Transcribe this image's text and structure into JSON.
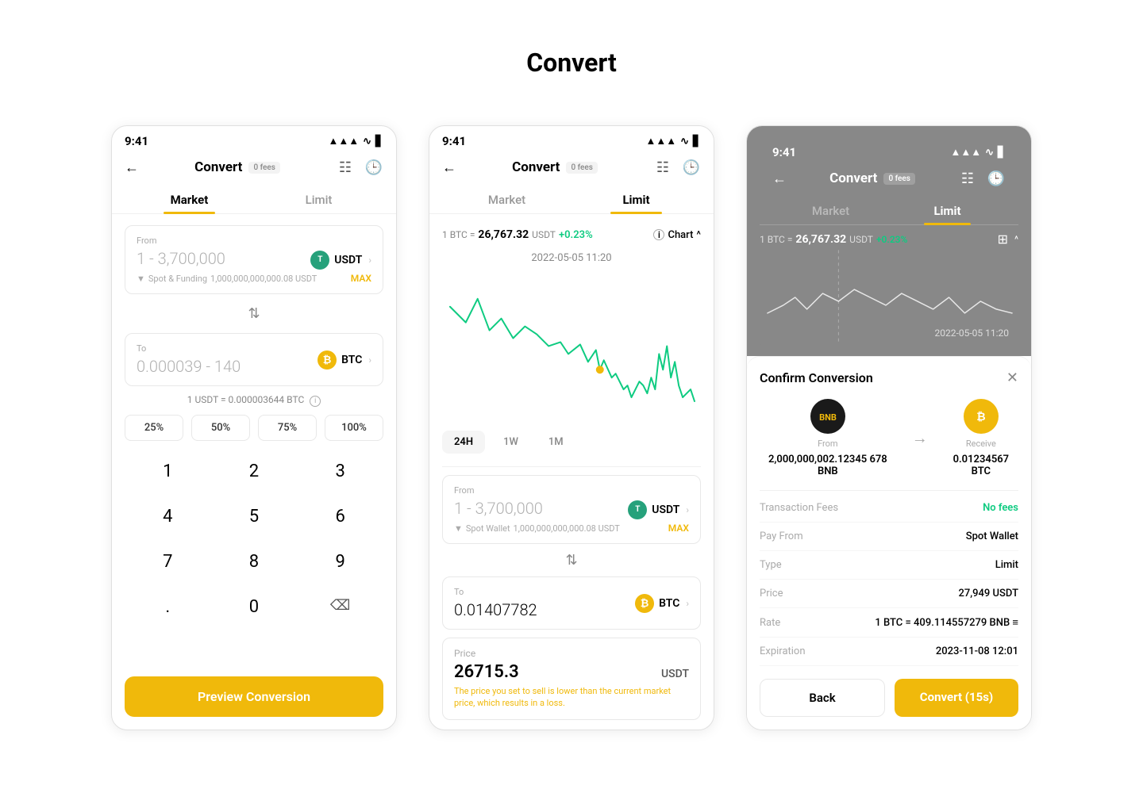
{
  "page": {
    "title": "Convert"
  },
  "screen1": {
    "status": {
      "time": "9:41",
      "signal": "▲▲▲",
      "wifi": "◀",
      "battery": "▋"
    },
    "header": {
      "title": "Convert",
      "badge": "0 fees"
    },
    "tabs": [
      {
        "label": "Market",
        "active": true
      },
      {
        "label": "Limit",
        "active": false
      }
    ],
    "from": {
      "label": "From",
      "value": "1 - 3,700,000",
      "currency": "USDT",
      "spot": "Spot & Funding",
      "balance": "1,000,000,000,000.08 USDT",
      "max": "MAX"
    },
    "to": {
      "label": "To",
      "value": "0.000039 - 140",
      "currency": "BTC"
    },
    "rate": "1 USDT = 0.000003644 BTC",
    "percentages": [
      "25%",
      "50%",
      "75%",
      "100%"
    ],
    "numpad": [
      "1",
      "2",
      "3",
      "4",
      "5",
      "6",
      "7",
      "8",
      "9",
      ".",
      "0",
      "⌫"
    ],
    "preview_btn": "Preview Conversion"
  },
  "screen2": {
    "status": {
      "time": "9:41"
    },
    "header": {
      "title": "Convert",
      "badge": "0 fees"
    },
    "tabs": [
      {
        "label": "Market",
        "active": false
      },
      {
        "label": "Limit",
        "active": true
      }
    ],
    "rate_info": "1 BTC = 26,767.32 USDT +0.23%",
    "chart_label": "Chart",
    "timestamp": "2022-05-05 11:20",
    "time_buttons": [
      {
        "label": "24H",
        "active": true
      },
      {
        "label": "1W",
        "active": false
      },
      {
        "label": "1M",
        "active": false
      }
    ],
    "from": {
      "label": "From",
      "value": "1 - 3,700,000",
      "currency": "USDT",
      "spot": "Spot Wallet",
      "balance": "1,000,000,000,000.08 USDT",
      "max": "MAX"
    },
    "to": {
      "label": "To",
      "value": "0.01407782",
      "currency": "BTC"
    },
    "price": {
      "label": "Price",
      "value": "26715.3",
      "currency": "USDT",
      "warning": "The price you set to sell is lower than the current market price, which results in a loss."
    }
  },
  "screen3": {
    "status": {
      "time": "9:41"
    },
    "header": {
      "title": "Convert",
      "badge": "0 fees"
    },
    "tabs": [
      {
        "label": "Market",
        "active": false
      },
      {
        "label": "Limit",
        "active": true
      }
    ],
    "rate_info": "1 BTC = 26,767.32 USDT +0.23%",
    "timestamp": "2022-05-05 11:20",
    "confirm": {
      "title": "Confirm Conversion",
      "from_label": "From",
      "from_value": "2,000,000,002.12345 678 BNB",
      "from_currency": "BNB",
      "receive_label": "Receive",
      "receive_value": "0.01234567 BTC",
      "receive_currency": "BTC"
    },
    "details": [
      {
        "label": "Transaction Fees",
        "value": "No fees",
        "green": true
      },
      {
        "label": "Pay From",
        "value": "Spot Wallet",
        "green": false
      },
      {
        "label": "Type",
        "value": "Limit",
        "green": false
      },
      {
        "label": "Price",
        "value": "27,949 USDT",
        "green": false
      },
      {
        "label": "Rate",
        "value": "1 BTC = 409.114557279 BNB ≡",
        "green": false
      },
      {
        "label": "Expiration",
        "value": "2023-11-08 12:01",
        "green": false
      }
    ],
    "back_btn": "Back",
    "convert_btn": "Convert (15s)"
  }
}
